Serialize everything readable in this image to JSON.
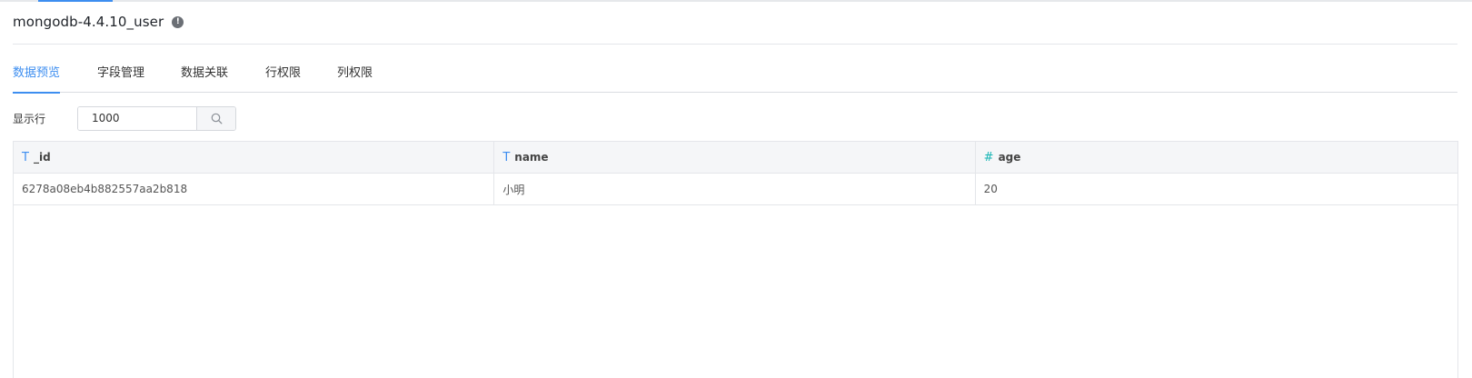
{
  "header": {
    "title": "mongodb-4.4.10_user",
    "info_icon_glyph": "!"
  },
  "tabs": [
    {
      "label": "数据预览",
      "active": true
    },
    {
      "label": "字段管理",
      "active": false
    },
    {
      "label": "数据关联",
      "active": false
    },
    {
      "label": "行权限",
      "active": false
    },
    {
      "label": "列权限",
      "active": false
    }
  ],
  "filter": {
    "label": "显示行",
    "value": "1000",
    "search_icon": "search-icon"
  },
  "table": {
    "columns": [
      {
        "name": "_id",
        "type_glyph": "T",
        "type": "text"
      },
      {
        "name": "name",
        "type_glyph": "T",
        "type": "text"
      },
      {
        "name": "age",
        "type_glyph": "#",
        "type": "number"
      }
    ],
    "rows": [
      [
        "6278a08eb4b882557aa2b818",
        "小明",
        "20"
      ]
    ]
  },
  "colors": {
    "accent": "#3d8ef0",
    "number_type": "#18b5b5"
  }
}
